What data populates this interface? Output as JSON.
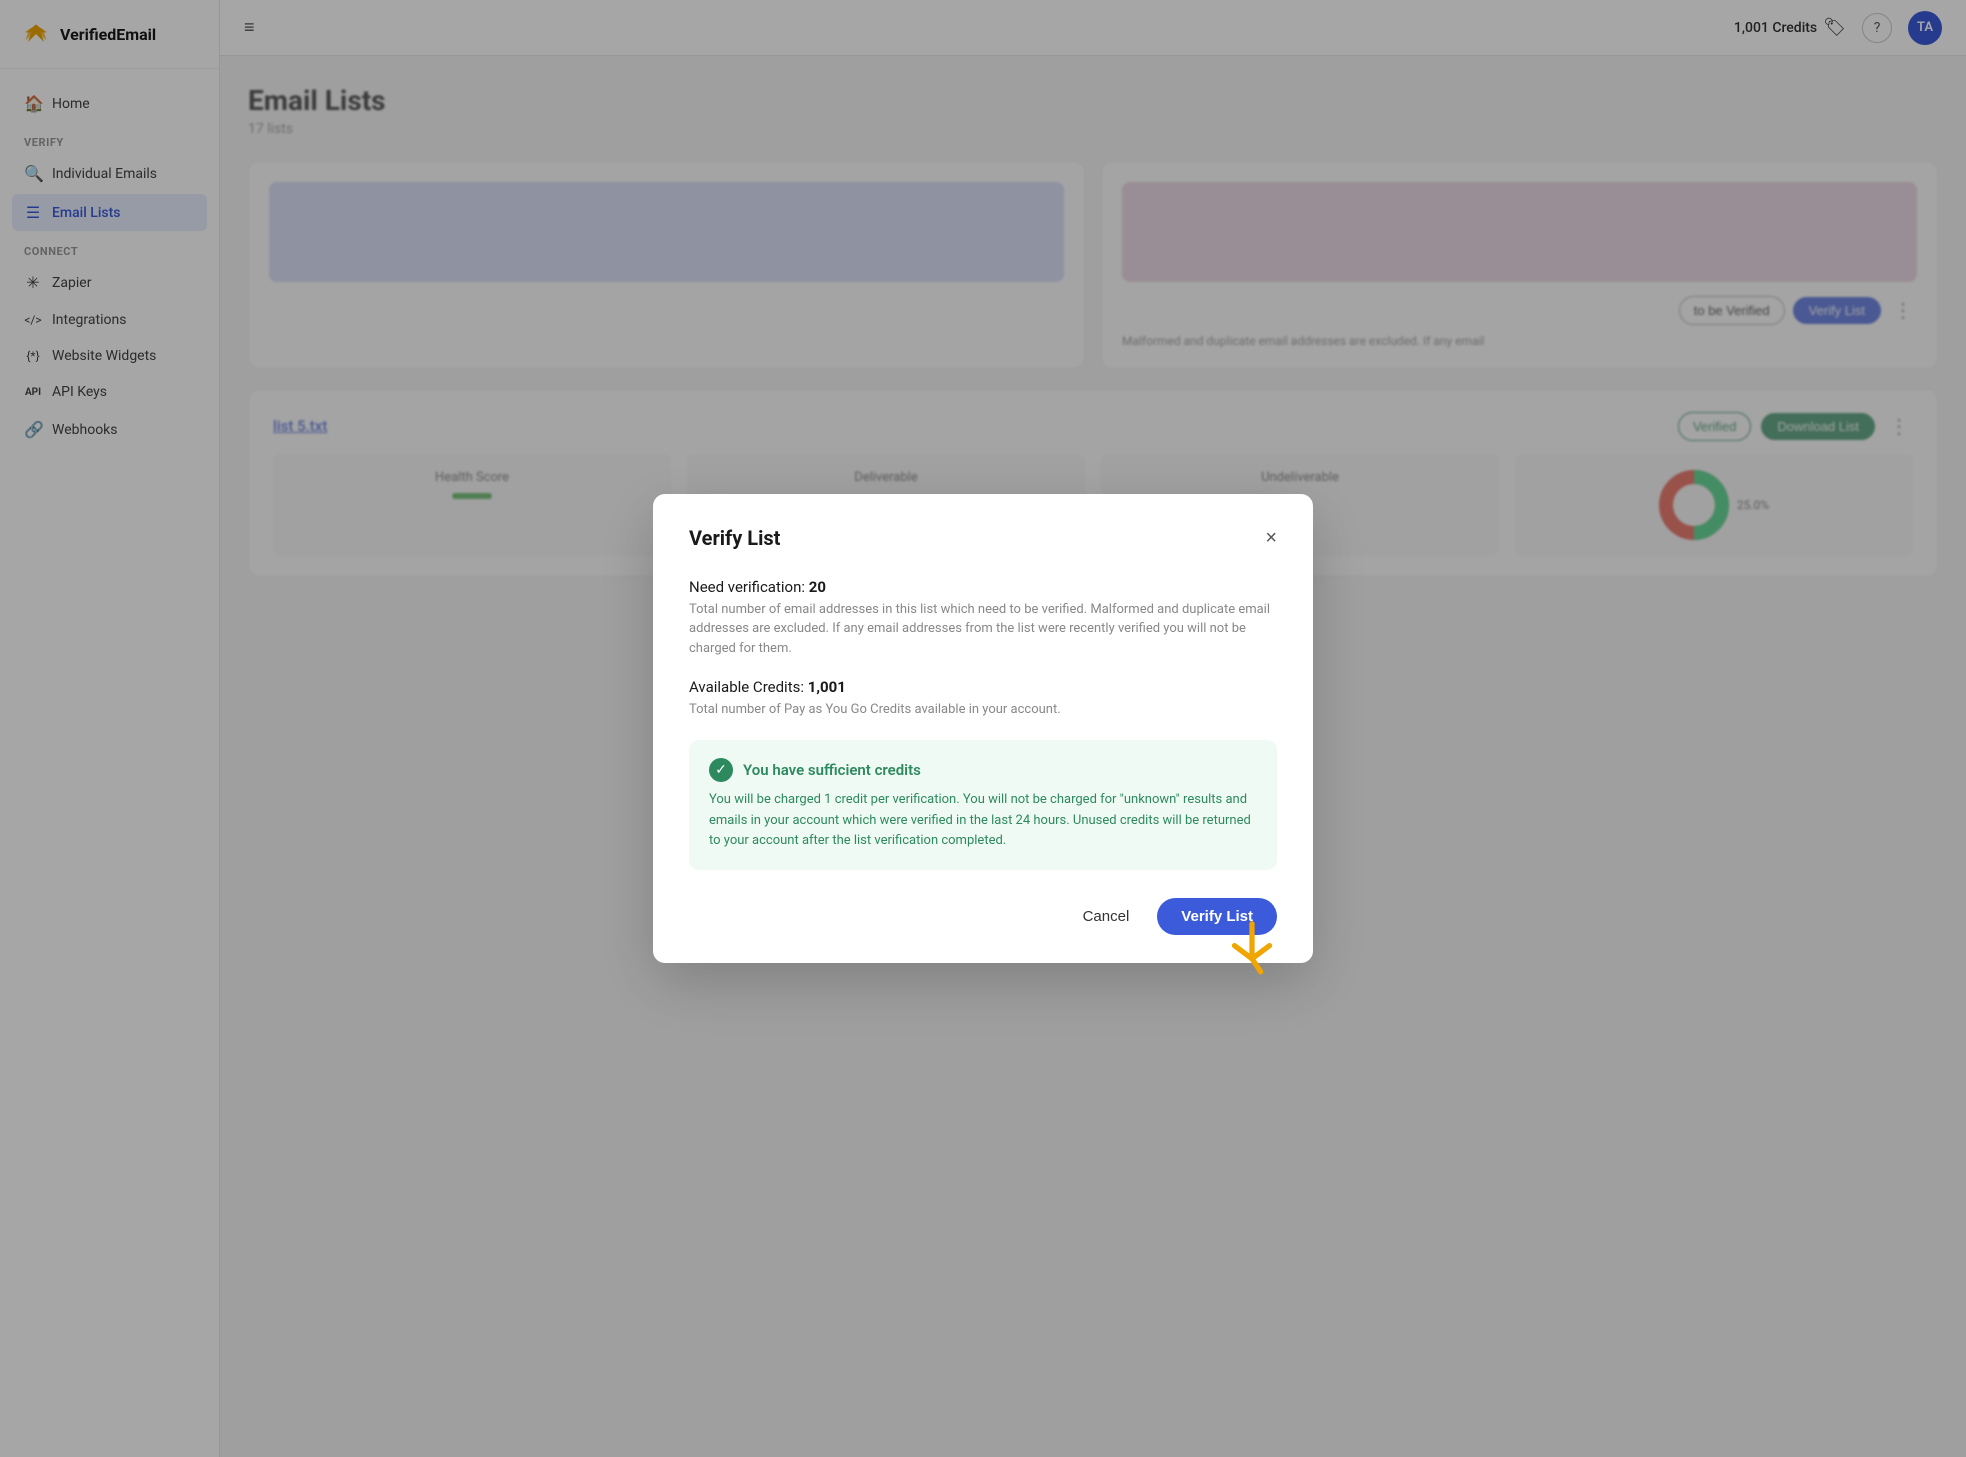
{
  "app": {
    "name": "VerifiedEmail"
  },
  "header": {
    "hamburger_label": "≡",
    "credits": "1,001 Credits",
    "credits_icon": "🏷",
    "help_icon": "?",
    "avatar_initials": "TA"
  },
  "sidebar": {
    "nav_items": [
      {
        "id": "home",
        "label": "Home",
        "icon": "🏠",
        "active": false
      },
      {
        "id": "individual-emails",
        "label": "Individual Emails",
        "icon": "🔍",
        "active": false
      },
      {
        "id": "email-lists",
        "label": "Email Lists",
        "icon": "☰",
        "active": true
      }
    ],
    "verify_section_label": "VERIFY",
    "connect_section_label": "CONNECT",
    "connect_items": [
      {
        "id": "zapier",
        "label": "Zapier",
        "icon": "✳"
      },
      {
        "id": "integrations",
        "label": "Integrations",
        "icon": "</>"
      },
      {
        "id": "website-widgets",
        "label": "Website Widgets",
        "icon": "{*}"
      },
      {
        "id": "api-keys",
        "label": "API Keys",
        "icon": "API"
      },
      {
        "id": "webhooks",
        "label": "Webhooks",
        "icon": "🔗"
      }
    ]
  },
  "page": {
    "title": "Email Lists",
    "subtitle": "17 lists"
  },
  "list_cards": [
    {
      "id": "card1",
      "color": "blue"
    },
    {
      "id": "card2",
      "color": "pink"
    }
  ],
  "list_detail": {
    "name": "list 5.txt",
    "status_label": "Verified",
    "download_label": "Download List",
    "health_score_label": "Health Score",
    "deliverable_label": "Deliverable",
    "undeliverable_label": "Undeliverable",
    "chart_percent": "25.0%"
  },
  "verify_list_card": {
    "to_be_verified_label": "to be Verified",
    "verify_list_label": "Verify List",
    "description": "Malformed and duplicate email addresses are excluded. If any email"
  },
  "modal": {
    "title": "Verify List",
    "close_icon": "×",
    "need_verification_label": "Need verification:",
    "need_verification_value": "20",
    "need_verification_desc": "Total number of email addresses in this list which need to be verified. Malformed and duplicate email addresses are excluded. If any email addresses from the list were recently verified you will not be charged for them.",
    "available_credits_label": "Available Credits:",
    "available_credits_value": "1,001",
    "available_credits_desc": "Total number of Pay as You Go Credits available in your account.",
    "success_title": "You have sufficient credits",
    "success_body": "You will be charged 1 credit per verification. You will not be charged for \"unknown\" results and emails in your account which were verified in the last 24 hours. Unused credits will be returned to your account after the list verification completed.",
    "cancel_label": "Cancel",
    "verify_label": "Verify List"
  }
}
